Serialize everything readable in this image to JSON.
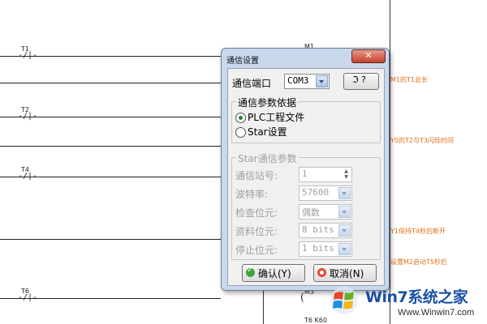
{
  "ladder": {
    "contacts": [
      {
        "name": "T1",
        "symbol": "-/|-"
      },
      {
        "name": "T2",
        "symbol": "-/|-"
      },
      {
        "name": "T4",
        "symbol": "-/|-"
      },
      {
        "name": "T6",
        "symbol": "-/|-"
      }
    ],
    "coil_labels": [
      "M1",
      "M3",
      "T6  K60"
    ],
    "comments": [
      "M1的T1总长",
      "Y0的T2与T3闪烁时间",
      "Y1保持T4秒后断开",
      "设置M2启动T5秒后"
    ],
    "comment_color": "#e2701a"
  },
  "dialog": {
    "title": "通信设置",
    "close_icon": "close-icon",
    "port_label": "通信端口",
    "port_value": "COM3",
    "help_button": "?",
    "source_group": {
      "title": "通信参数依据",
      "options": [
        {
          "label": "PLC工程文件",
          "selected": true
        },
        {
          "label": "Star设置",
          "selected": false
        }
      ]
    },
    "star_group": {
      "title": "Star通信参数",
      "fields": [
        {
          "label": "通信站号:",
          "value": "1"
        },
        {
          "label": "波特率:",
          "value": "57600"
        },
        {
          "label": "检查位元:",
          "value": "偶数"
        },
        {
          "label": "资料位元:",
          "value": "8 bits"
        },
        {
          "label": "停止位元:",
          "value": "1 bits"
        }
      ]
    },
    "ok_button": "确认(Y)",
    "cancel_button": "取消(N)"
  },
  "watermark": {
    "brand": "Win7系统之家",
    "url": "Www.Winwin7.com"
  }
}
